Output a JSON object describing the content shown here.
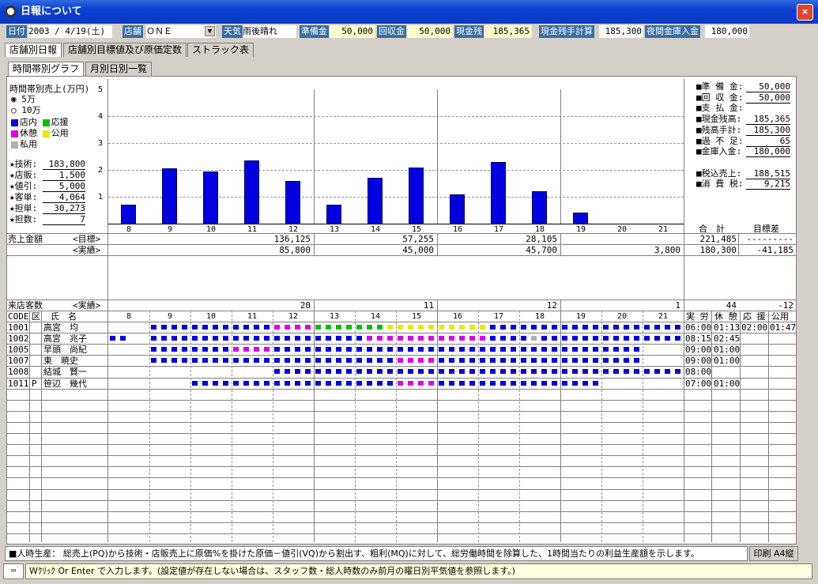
{
  "window": {
    "title": "日報について",
    "close": "×"
  },
  "header": {
    "date_label": "日付",
    "date_value": "2003 / 4/19(土)",
    "store_label": "店舗",
    "store_value": "ＯＮＥ",
    "weather_label": "天気",
    "weather_value": "雨後晴れ",
    "prep_label": "準備金",
    "prep_value": "50,000",
    "recov_label": "回収金",
    "recov_value": "50,000",
    "cash_label": "現金残",
    "cash_value": "185,365",
    "calc_label": "現金残手計算",
    "calc_value": "185,300",
    "night_label": "夜間金庫入金",
    "night_value": "180,000"
  },
  "tabs": [
    "店舗別日報",
    "店舗別目標値及び原価定数",
    "ストラック表"
  ],
  "subtabs": [
    "時間帯別グラフ",
    "月別日別一覧"
  ],
  "left": {
    "chart_title": "時間帯別売上(万円)",
    "radio1": "5万",
    "radio2": "10万",
    "legend": [
      {
        "label": "店内",
        "color": "#0000e0"
      },
      {
        "label": "応援",
        "color": "#00c000"
      },
      {
        "label": "休憩",
        "color": "#e000e0"
      },
      {
        "label": "公用",
        "color": "#e8e800"
      },
      {
        "label": "私用",
        "color": "#b0b0b0"
      }
    ],
    "stats": [
      [
        "★技術:",
        "183,800"
      ],
      [
        "★店販:",
        "1,500"
      ],
      [
        "★値引:",
        "5,000"
      ],
      [
        "★客単:",
        "4,064"
      ],
      [
        "★担単:",
        "30,273"
      ],
      [
        "★担数:",
        "7"
      ]
    ]
  },
  "right_stats": [
    [
      "■準 備 金:",
      "50,000"
    ],
    [
      "■回 収 金:",
      "50,000"
    ],
    [
      "■支 払 金:",
      ""
    ],
    [
      "■現金残高:",
      "185,365"
    ],
    [
      "■残高手計:",
      "185,300"
    ],
    [
      "■過 不 足:",
      "65"
    ],
    [
      "■金庫入金:",
      "180,000"
    ],
    [
      "",
      ""
    ],
    [
      "■税込売上:",
      "188,515"
    ],
    [
      "■消 費 税:",
      "9,215"
    ]
  ],
  "chart_data": {
    "type": "bar",
    "categories": [
      "8",
      "9",
      "10",
      "11",
      "12",
      "13",
      "14",
      "15",
      "16",
      "17",
      "18",
      "19",
      "20",
      "21"
    ],
    "values": [
      0.7,
      2.05,
      1.95,
      2.35,
      1.6,
      0.7,
      1.7,
      2.1,
      1.1,
      2.3,
      1.2,
      0.4,
      0,
      0
    ],
    "ylim": [
      0,
      5
    ],
    "yticks": [
      "5",
      "4",
      "3",
      "2",
      "1"
    ],
    "grid": true
  },
  "sales": {
    "label": "売上金額",
    "target_label": "<目標>",
    "actual_label": "<実績>",
    "target": [
      "136,125",
      "57,255",
      "28,105",
      ""
    ],
    "actual": [
      "85,800",
      "45,000",
      "45,700",
      "3,800"
    ],
    "total_header": "合　計",
    "diff_header": "目標差",
    "total_target": "221,485",
    "diff_target": "---------",
    "total_actual": "180,300",
    "diff_actual": "-41,185"
  },
  "visitors": {
    "label": "来店客数",
    "sub": "<実績>",
    "values": [
      "20",
      "11",
      "12",
      "1"
    ],
    "total": "44",
    "diff": "-12"
  },
  "staff_header": {
    "code": "CODE",
    "kubun": "区",
    "name": "氏　名",
    "work": "実 労",
    "rest": "休 憩",
    "help": "応 援",
    "public": "公用"
  },
  "staff": [
    {
      "code": "1001",
      "kubun": "",
      "name": "高宮　均",
      "work": "06:00",
      "rest": "01:13",
      "help": "02:00",
      "public": "01:47",
      "slots": "0000000000000000000000111111111111112222222333333344444444111111111111111111111111000000000000000"
    },
    {
      "code": "1002",
      "kubun": "",
      "name": "高宮　兆子",
      "work": "08:15",
      "rest": "02:45",
      "help": "",
      "public": "",
      "slots": ""
    },
    {
      "code": "1005",
      "kubun": "",
      "name": "早頭　尚紀",
      "work": "09:00",
      "rest": "01:00",
      "help": "",
      "public": "",
      "slots": ""
    },
    {
      "code": "1007",
      "kubun": "",
      "name": "東　暁史",
      "work": "09:00",
      "rest": "01:00",
      "help": "",
      "public": "",
      "slots": ""
    },
    {
      "code": "1008",
      "kubun": "",
      "name": "結城　賢一",
      "work": "08:00",
      "rest": "",
      "help": "",
      "public": "",
      "slots": ""
    },
    {
      "code": "1011",
      "kubun": "P",
      "name": "笹辺　幾代",
      "work": "07:00",
      "rest": "01:00",
      "help": "",
      "public": "",
      "slots": ""
    }
  ],
  "footer": {
    "note": "■人時生産： 総売上(PQ)から技術・店販売上に原価%を掛けた原価－値引(VQ)から割出す、粗利(MQ)に対して、総労働時間を除算した、1時間当たりの利益生産額を示します。",
    "print": "印刷 A4縦",
    "status": "Wｸﾘｯｸ Or Enter で入力します。(設定値が存在しない場合は、スタッフ数・総人時数のみ前月の曜日別平気値を参照します。)"
  }
}
